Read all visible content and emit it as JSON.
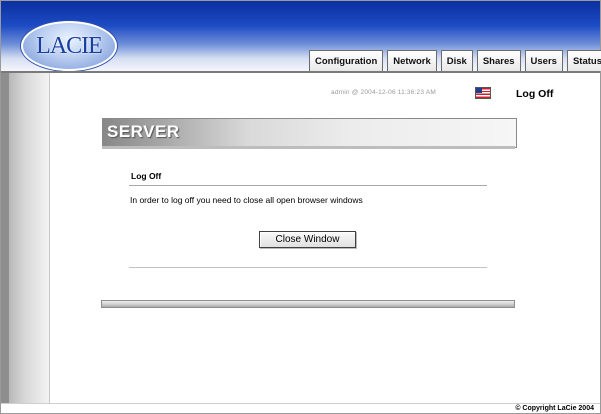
{
  "header": {
    "logo_text": "LACIE",
    "tabs": [
      {
        "label": "Configuration"
      },
      {
        "label": "Network"
      },
      {
        "label": "Disk"
      },
      {
        "label": "Shares"
      },
      {
        "label": "Users"
      },
      {
        "label": "Status"
      }
    ]
  },
  "session": {
    "user_info": "admin @ 2004-12-06 11:36:23 AM",
    "flag_icon": "us-flag-icon",
    "logoff_label": "Log Off"
  },
  "main": {
    "banner_title": "SERVER",
    "section_title": "Log Off",
    "message": "In order to log off you need to close all open browser windows",
    "close_button_label": "Close Window"
  },
  "footer": {
    "copyright": "© Copyright LaCie 2004"
  },
  "colors": {
    "header_blue": "#1d4bc4",
    "logo_blue": "#1a3fa0",
    "panel_gray": "#d9d9d9"
  }
}
